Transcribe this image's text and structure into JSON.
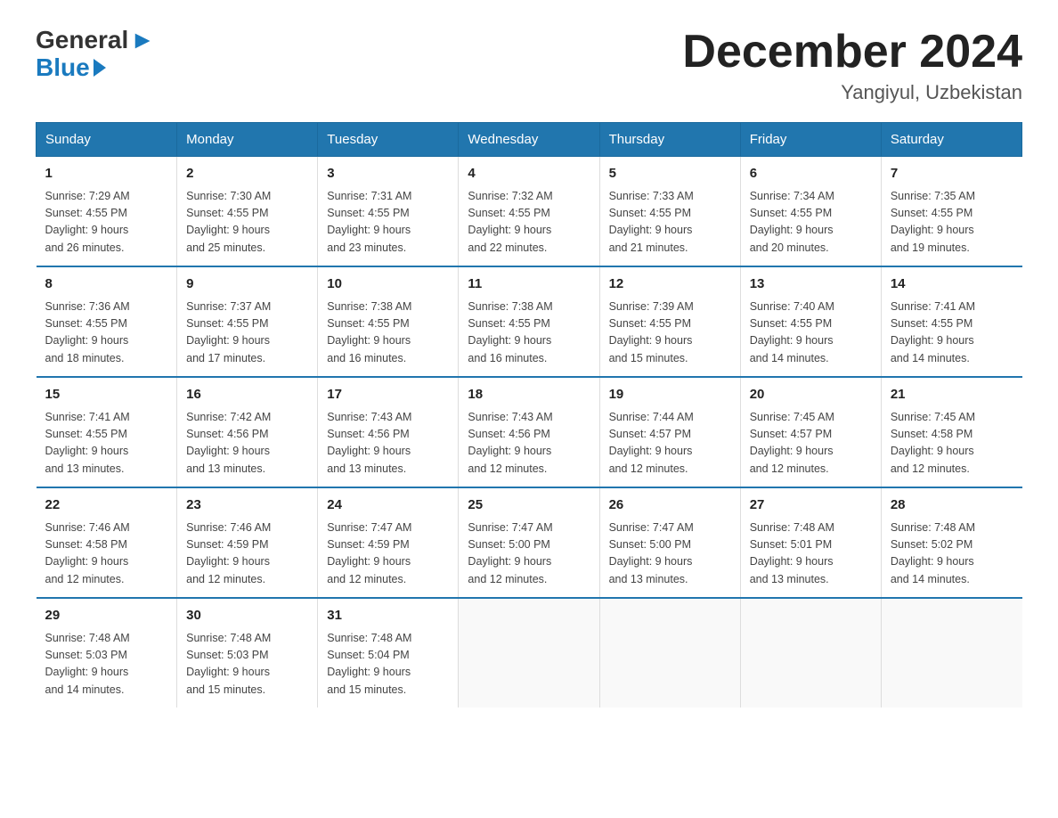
{
  "header": {
    "logo_general": "General",
    "logo_blue": "Blue",
    "month_title": "December 2024",
    "location": "Yangiyul, Uzbekistan"
  },
  "weekdays": [
    "Sunday",
    "Monday",
    "Tuesday",
    "Wednesday",
    "Thursday",
    "Friday",
    "Saturday"
  ],
  "weeks": [
    [
      {
        "day": "1",
        "sunrise": "7:29 AM",
        "sunset": "4:55 PM",
        "daylight": "9 hours and 26 minutes."
      },
      {
        "day": "2",
        "sunrise": "7:30 AM",
        "sunset": "4:55 PM",
        "daylight": "9 hours and 25 minutes."
      },
      {
        "day": "3",
        "sunrise": "7:31 AM",
        "sunset": "4:55 PM",
        "daylight": "9 hours and 23 minutes."
      },
      {
        "day": "4",
        "sunrise": "7:32 AM",
        "sunset": "4:55 PM",
        "daylight": "9 hours and 22 minutes."
      },
      {
        "day": "5",
        "sunrise": "7:33 AM",
        "sunset": "4:55 PM",
        "daylight": "9 hours and 21 minutes."
      },
      {
        "day": "6",
        "sunrise": "7:34 AM",
        "sunset": "4:55 PM",
        "daylight": "9 hours and 20 minutes."
      },
      {
        "day": "7",
        "sunrise": "7:35 AM",
        "sunset": "4:55 PM",
        "daylight": "9 hours and 19 minutes."
      }
    ],
    [
      {
        "day": "8",
        "sunrise": "7:36 AM",
        "sunset": "4:55 PM",
        "daylight": "9 hours and 18 minutes."
      },
      {
        "day": "9",
        "sunrise": "7:37 AM",
        "sunset": "4:55 PM",
        "daylight": "9 hours and 17 minutes."
      },
      {
        "day": "10",
        "sunrise": "7:38 AM",
        "sunset": "4:55 PM",
        "daylight": "9 hours and 16 minutes."
      },
      {
        "day": "11",
        "sunrise": "7:38 AM",
        "sunset": "4:55 PM",
        "daylight": "9 hours and 16 minutes."
      },
      {
        "day": "12",
        "sunrise": "7:39 AM",
        "sunset": "4:55 PM",
        "daylight": "9 hours and 15 minutes."
      },
      {
        "day": "13",
        "sunrise": "7:40 AM",
        "sunset": "4:55 PM",
        "daylight": "9 hours and 14 minutes."
      },
      {
        "day": "14",
        "sunrise": "7:41 AM",
        "sunset": "4:55 PM",
        "daylight": "9 hours and 14 minutes."
      }
    ],
    [
      {
        "day": "15",
        "sunrise": "7:41 AM",
        "sunset": "4:55 PM",
        "daylight": "9 hours and 13 minutes."
      },
      {
        "day": "16",
        "sunrise": "7:42 AM",
        "sunset": "4:56 PM",
        "daylight": "9 hours and 13 minutes."
      },
      {
        "day": "17",
        "sunrise": "7:43 AM",
        "sunset": "4:56 PM",
        "daylight": "9 hours and 13 minutes."
      },
      {
        "day": "18",
        "sunrise": "7:43 AM",
        "sunset": "4:56 PM",
        "daylight": "9 hours and 12 minutes."
      },
      {
        "day": "19",
        "sunrise": "7:44 AM",
        "sunset": "4:57 PM",
        "daylight": "9 hours and 12 minutes."
      },
      {
        "day": "20",
        "sunrise": "7:45 AM",
        "sunset": "4:57 PM",
        "daylight": "9 hours and 12 minutes."
      },
      {
        "day": "21",
        "sunrise": "7:45 AM",
        "sunset": "4:58 PM",
        "daylight": "9 hours and 12 minutes."
      }
    ],
    [
      {
        "day": "22",
        "sunrise": "7:46 AM",
        "sunset": "4:58 PM",
        "daylight": "9 hours and 12 minutes."
      },
      {
        "day": "23",
        "sunrise": "7:46 AM",
        "sunset": "4:59 PM",
        "daylight": "9 hours and 12 minutes."
      },
      {
        "day": "24",
        "sunrise": "7:47 AM",
        "sunset": "4:59 PM",
        "daylight": "9 hours and 12 minutes."
      },
      {
        "day": "25",
        "sunrise": "7:47 AM",
        "sunset": "5:00 PM",
        "daylight": "9 hours and 12 minutes."
      },
      {
        "day": "26",
        "sunrise": "7:47 AM",
        "sunset": "5:00 PM",
        "daylight": "9 hours and 13 minutes."
      },
      {
        "day": "27",
        "sunrise": "7:48 AM",
        "sunset": "5:01 PM",
        "daylight": "9 hours and 13 minutes."
      },
      {
        "day": "28",
        "sunrise": "7:48 AM",
        "sunset": "5:02 PM",
        "daylight": "9 hours and 14 minutes."
      }
    ],
    [
      {
        "day": "29",
        "sunrise": "7:48 AM",
        "sunset": "5:03 PM",
        "daylight": "9 hours and 14 minutes."
      },
      {
        "day": "30",
        "sunrise": "7:48 AM",
        "sunset": "5:03 PM",
        "daylight": "9 hours and 15 minutes."
      },
      {
        "day": "31",
        "sunrise": "7:48 AM",
        "sunset": "5:04 PM",
        "daylight": "9 hours and 15 minutes."
      },
      null,
      null,
      null,
      null
    ]
  ],
  "labels": {
    "sunrise": "Sunrise:",
    "sunset": "Sunset:",
    "daylight": "Daylight:"
  }
}
